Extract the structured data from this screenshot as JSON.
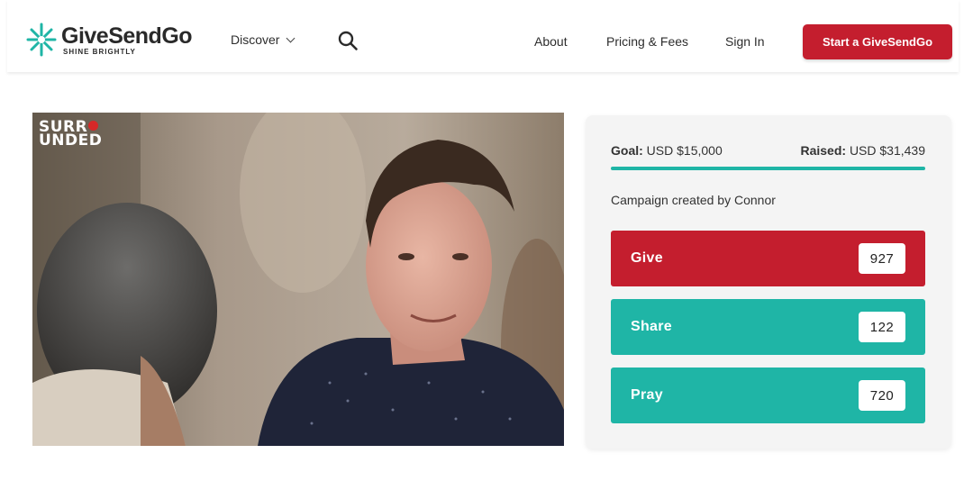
{
  "header": {
    "logo_name": "GiveSendGo",
    "logo_tagline": "SHINE BRIGHTLY",
    "discover_label": "Discover",
    "nav": {
      "about": "About",
      "pricing": "Pricing & Fees",
      "signin": "Sign In"
    },
    "cta_label": "Start a GiveSendGo"
  },
  "hero": {
    "watermark_line1": "SURR",
    "watermark_line2": "UNDED"
  },
  "campaign": {
    "goal_label": "Goal:",
    "goal_value": "USD $15,000",
    "raised_label": "Raised:",
    "raised_value": "USD $31,439",
    "progress_fraction": 1.0,
    "creator_prefix": "Campaign created by",
    "creator_name": "Connor",
    "actions": [
      {
        "label": "Give",
        "count": "927"
      },
      {
        "label": "Share",
        "count": "122"
      },
      {
        "label": "Pray",
        "count": "720"
      }
    ]
  },
  "colors": {
    "brand_red": "#c41e2e",
    "brand_teal": "#1fb5a6"
  },
  "icons": [
    "logo-burst-icon",
    "chevron-down-icon",
    "search-icon"
  ]
}
